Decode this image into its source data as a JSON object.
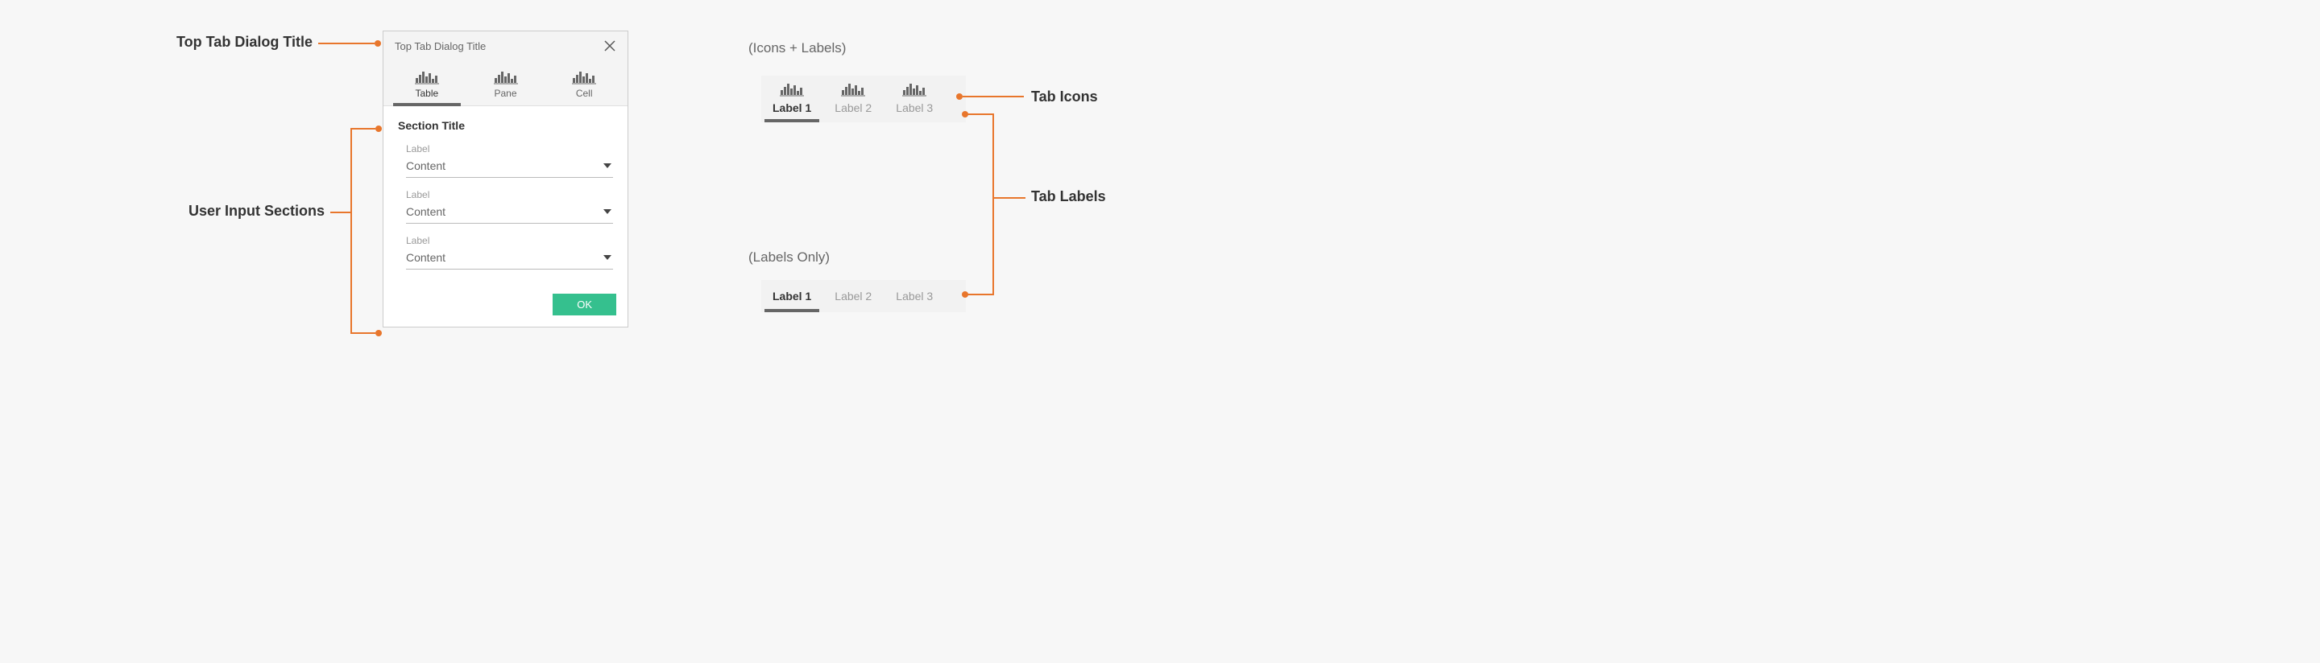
{
  "callouts": {
    "dialog_title": "Top Tab Dialog Title",
    "user_input_sections": "User Input Sections",
    "tab_icons": "Tab Icons",
    "tab_labels": "Tab Labels"
  },
  "dialog": {
    "title": "Top Tab Dialog Title",
    "tabs": [
      {
        "label": "Table",
        "selected": true
      },
      {
        "label": "Pane",
        "selected": false
      },
      {
        "label": "Cell",
        "selected": false
      }
    ],
    "section_title": "Section Title",
    "fields": [
      {
        "label": "Label",
        "content": "Content"
      },
      {
        "label": "Label",
        "content": "Content"
      },
      {
        "label": "Label",
        "content": "Content"
      }
    ],
    "ok_button": "OK"
  },
  "demo": {
    "header_icons_labels": "(Icons + Labels)",
    "header_labels_only": "(Labels Only)",
    "tabs": [
      {
        "label": "Label 1",
        "selected": true
      },
      {
        "label": "Label 2",
        "selected": false
      },
      {
        "label": "Label 3",
        "selected": false
      }
    ]
  }
}
